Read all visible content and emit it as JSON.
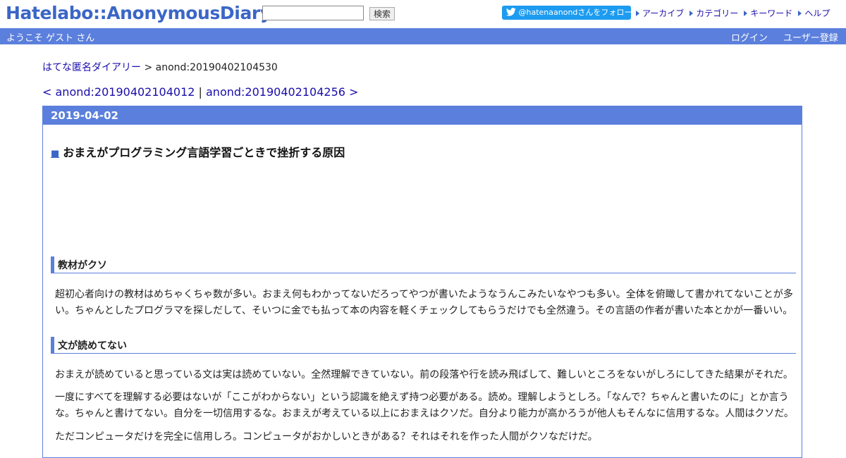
{
  "header": {
    "logo": "Hatelabo::AnonymousDiary",
    "search_placeholder": "",
    "search_button": "検索",
    "twitter_follow": "@hatenaanondさんをフォロー",
    "links": [
      "アーカイブ",
      "カテゴリー",
      "キーワード",
      "ヘルプ"
    ]
  },
  "userbar": {
    "welcome": "ようこそ ゲスト さん",
    "login": "ログイン",
    "register": "ユーザー登録"
  },
  "breadcrumb": {
    "home": "はてな匿名ダイアリー",
    "current": " > anond:20190402104530"
  },
  "pager": {
    "prev": "< anond:20190402104012",
    "separator": " | ",
    "next": "anond:20190402104256 >"
  },
  "entry": {
    "date": "2019-04-02",
    "title_mark": "■",
    "title": "おまえがプログラミング言語学習ごときで挫折する原因",
    "sections": [
      {
        "heading": "教材がクソ",
        "paragraphs": [
          "超初心者向けの教材はめちゃくちゃ数が多い。おまえ何もわかってないだろってやつが書いたようなうんこみたいなやつも多い。全体を俯瞰して書かれてないことが多い。ちゃんとしたプログラマを探しだして、そいつに金でも払って本の内容を軽くチェックしてもらうだけでも全然違う。その言語の作者が書いた本とかが一番いい。"
        ]
      },
      {
        "heading": "文が読めてない",
        "paragraphs": [
          "おまえが読めていると思っている文は実は読めていない。全然理解できていない。前の段落や行を読み飛ばして、難しいところをないがしろにしてきた結果がそれだ。",
          "一度にすべてを理解する必要はないが「ここがわからない」という認識を絶えず持つ必要がある。読め。理解しようとしろ。「なんで？ちゃんと書いたのに」とか言うな。ちゃんと書けてない。自分を一切信用するな。おまえが考えている以上におまえはクソだ。自分より能力が高かろうが他人もそんなに信用するな。人間はクソだ。",
          "ただコンピュータだけを完全に信用しろ。コンピュータがおかしいときがある？それはそれを作った人間がクソなだけだ。"
        ]
      }
    ]
  }
}
